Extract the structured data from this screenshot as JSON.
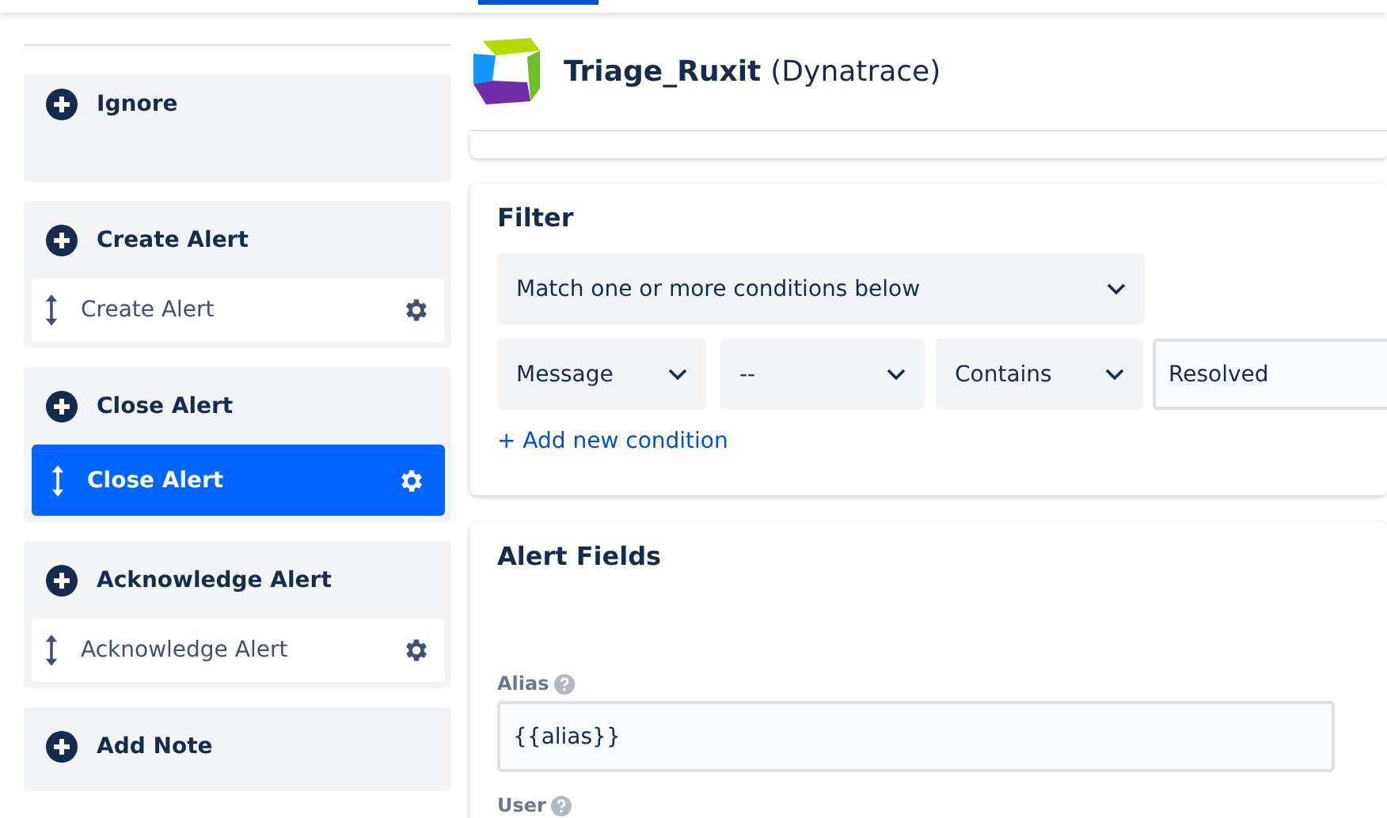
{
  "sidebar": {
    "groups": [
      {
        "title": "Ignore"
      },
      {
        "title": "Create Alert",
        "actions": [
          {
            "label": "Create Alert",
            "selected": false
          }
        ]
      },
      {
        "title": "Close Alert",
        "actions": [
          {
            "label": "Close Alert",
            "selected": true
          }
        ]
      },
      {
        "title": "Acknowledge Alert",
        "actions": [
          {
            "label": "Acknowledge Alert",
            "selected": false
          }
        ]
      },
      {
        "title": "Add Note"
      }
    ]
  },
  "header": {
    "name": "Triage_Ruxit",
    "source": "(Dynatrace)"
  },
  "filter": {
    "title": "Filter",
    "match": "Match one or more conditions below",
    "condition": [
      {
        "kind": "select",
        "value": "Message"
      },
      {
        "kind": "select",
        "value": "--"
      },
      {
        "kind": "select",
        "value": "Contains"
      },
      {
        "kind": "input",
        "value": "Resolved"
      }
    ],
    "add_link": "+ Add new condition"
  },
  "alert_fields": {
    "title": "Alert Fields",
    "fields": [
      {
        "label": "Alias",
        "value": "{{alias}}"
      },
      {
        "label": "User"
      }
    ]
  }
}
